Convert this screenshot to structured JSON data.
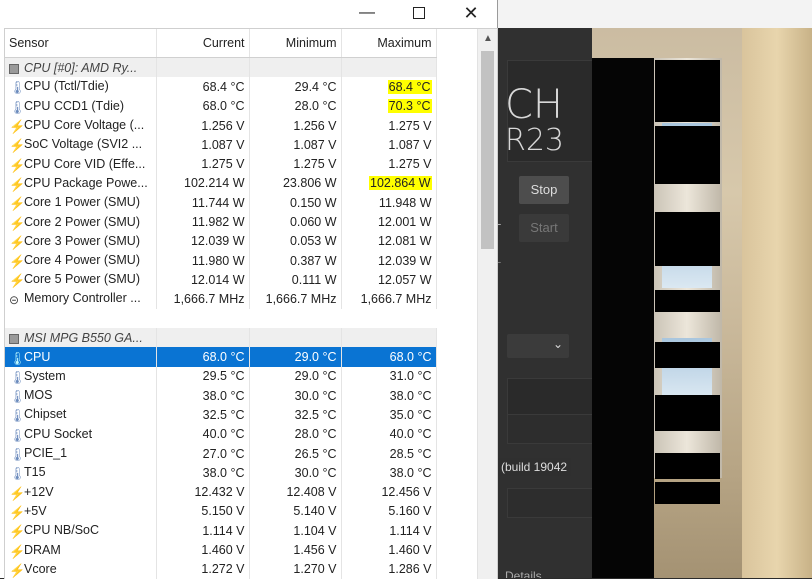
{
  "window": {
    "minimize_icon": "minimize-icon",
    "maximize_icon": "maximize-icon",
    "close_icon": "close-icon"
  },
  "columns": {
    "sensor": "Sensor",
    "current": "Current",
    "minimum": "Minimum",
    "maximum": "Maximum"
  },
  "rows": [
    {
      "type": "group",
      "icon": "chip",
      "name": "CPU [#0]: AMD Ry..."
    },
    {
      "type": "sensor",
      "icon": "therm",
      "name": "CPU (Tctl/Tdie)",
      "current": "68.4 °C",
      "min": "29.4 °C",
      "max": "68.4 °C",
      "max_highlight": true
    },
    {
      "type": "sensor",
      "icon": "therm",
      "name": "CPU CCD1 (Tdie)",
      "current": "68.0 °C",
      "min": "28.0 °C",
      "max": "70.3 °C",
      "max_highlight": true
    },
    {
      "type": "sensor",
      "icon": "bolt",
      "name": "CPU Core Voltage (...",
      "current": "1.256 V",
      "min": "1.256 V",
      "max": "1.275 V"
    },
    {
      "type": "sensor",
      "icon": "bolt",
      "name": "SoC Voltage (SVI2 ...",
      "current": "1.087 V",
      "min": "1.087 V",
      "max": "1.087 V"
    },
    {
      "type": "sensor",
      "icon": "bolt",
      "name": "CPU Core VID (Effe...",
      "current": "1.275 V",
      "min": "1.275 V",
      "max": "1.275 V"
    },
    {
      "type": "sensor",
      "icon": "bolt",
      "name": "CPU Package Powe...",
      "current": "102.214 W",
      "min": "23.806 W",
      "max": "102.864 W",
      "max_highlight": true
    },
    {
      "type": "sensor",
      "icon": "bolt",
      "name": "Core 1 Power (SMU)",
      "current": "11.744 W",
      "min": "0.150 W",
      "max": "11.948 W"
    },
    {
      "type": "sensor",
      "icon": "bolt",
      "name": "Core 2 Power (SMU)",
      "current": "11.982 W",
      "min": "0.060 W",
      "max": "12.001 W"
    },
    {
      "type": "sensor",
      "icon": "bolt",
      "name": "Core 3 Power (SMU)",
      "current": "12.039 W",
      "min": "0.053 W",
      "max": "12.081 W"
    },
    {
      "type": "sensor",
      "icon": "bolt",
      "name": "Core 4 Power (SMU)",
      "current": "11.980 W",
      "min": "0.387 W",
      "max": "12.039 W"
    },
    {
      "type": "sensor",
      "icon": "bolt",
      "name": "Core 5 Power (SMU)",
      "current": "12.014 W",
      "min": "0.111 W",
      "max": "12.057 W"
    },
    {
      "type": "sensor",
      "icon": "mem",
      "name": "Memory Controller ...",
      "current": "1,666.7 MHz",
      "min": "1,666.7 MHz",
      "max": "1,666.7 MHz"
    },
    {
      "type": "spacer"
    },
    {
      "type": "group",
      "icon": "chip",
      "name": "MSI MPG B550 GA..."
    },
    {
      "type": "sensor",
      "icon": "therm",
      "name": "CPU",
      "current": "68.0 °C",
      "min": "29.0 °C",
      "max": "68.0 °C",
      "selected": true
    },
    {
      "type": "sensor",
      "icon": "therm",
      "name": "System",
      "current": "29.5 °C",
      "min": "29.0 °C",
      "max": "31.0 °C"
    },
    {
      "type": "sensor",
      "icon": "therm",
      "name": "MOS",
      "current": "38.0 °C",
      "min": "30.0 °C",
      "max": "38.0 °C"
    },
    {
      "type": "sensor",
      "icon": "therm",
      "name": "Chipset",
      "current": "32.5 °C",
      "min": "32.5 °C",
      "max": "35.0 °C"
    },
    {
      "type": "sensor",
      "icon": "therm",
      "name": "CPU Socket",
      "current": "40.0 °C",
      "min": "28.0 °C",
      "max": "40.0 °C"
    },
    {
      "type": "sensor",
      "icon": "therm",
      "name": "PCIE_1",
      "current": "27.0 °C",
      "min": "26.5 °C",
      "max": "28.5 °C"
    },
    {
      "type": "sensor",
      "icon": "therm",
      "name": "T15",
      "current": "38.0 °C",
      "min": "30.0 °C",
      "max": "38.0 °C"
    },
    {
      "type": "sensor",
      "icon": "bolt",
      "name": "+12V",
      "current": "12.432 V",
      "min": "12.408 V",
      "max": "12.456 V"
    },
    {
      "type": "sensor",
      "icon": "bolt",
      "name": "+5V",
      "current": "5.150 V",
      "min": "5.140 V",
      "max": "5.160 V"
    },
    {
      "type": "sensor",
      "icon": "bolt",
      "name": "CPU NB/SoC",
      "current": "1.114 V",
      "min": "1.104 V",
      "max": "1.114 V"
    },
    {
      "type": "sensor",
      "icon": "bolt",
      "name": "DRAM",
      "current": "1.460 V",
      "min": "1.456 V",
      "max": "1.460 V"
    },
    {
      "type": "sensor",
      "icon": "bolt",
      "name": "Vcore",
      "current": "1.272 V",
      "min": "1.270 V",
      "max": "1.286 V"
    }
  ],
  "background_app": {
    "big_text_1": "CH",
    "big_text_2": "R23",
    "stop_label": "Stop",
    "start_label": "Start",
    "dash_1": "-",
    "dash_2": "-",
    "build_text": "(build 19042",
    "details_text": "Details"
  },
  "colors": {
    "selection": "#0a74d3",
    "highlight": "#ffff00",
    "group_bg": "#efefef"
  }
}
